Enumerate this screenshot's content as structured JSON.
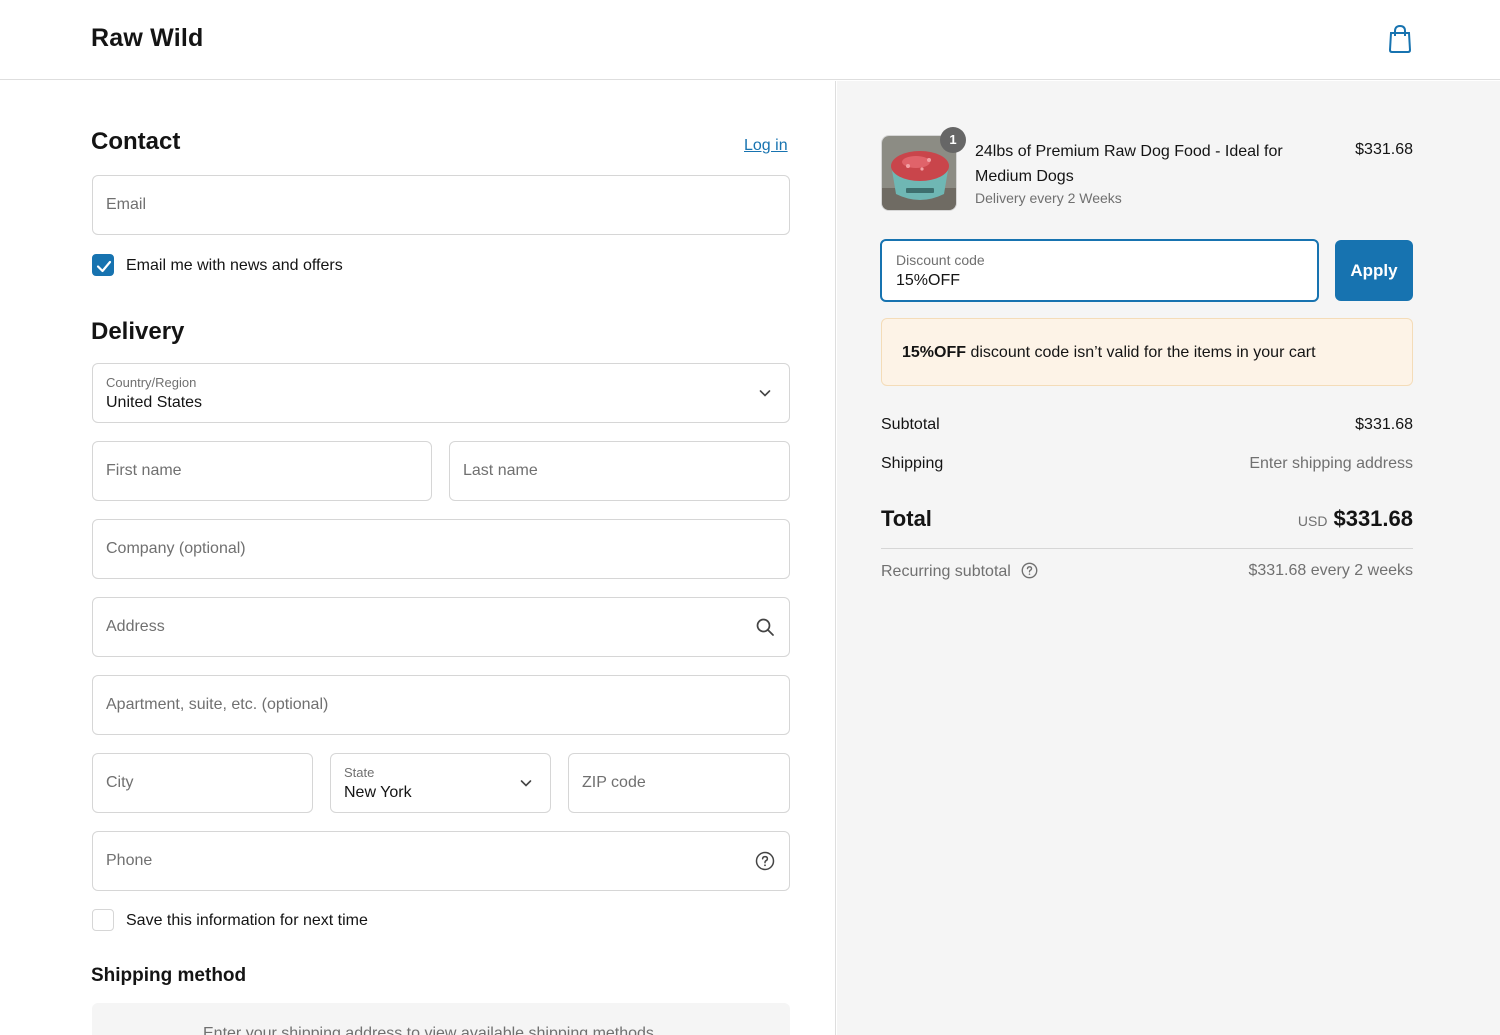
{
  "header": {
    "brand": "Raw Wild",
    "cart_icon": "shopping-bag-icon"
  },
  "contact": {
    "title": "Contact",
    "login_link": "Log in",
    "email_placeholder": "Email",
    "newsletter_label": "Email me with news and offers",
    "newsletter_checked": true
  },
  "delivery": {
    "title": "Delivery",
    "country_label": "Country/Region",
    "country_value": "United States",
    "first_name_placeholder": "First name",
    "last_name_placeholder": "Last name",
    "company_placeholder": "Company (optional)",
    "address_placeholder": "Address",
    "apartment_placeholder": "Apartment, suite, etc. (optional)",
    "city_placeholder": "City",
    "state_label": "State",
    "state_value": "New York",
    "zip_placeholder": "ZIP code",
    "phone_placeholder": "Phone",
    "save_info_label": "Save this information for next time",
    "save_info_checked": false
  },
  "shipping_method": {
    "title": "Shipping method",
    "placeholder_text": "Enter your shipping address to view available shipping methods."
  },
  "summary": {
    "product": {
      "quantity": "1",
      "name": "24lbs of Premium Raw Dog Food - Ideal for Medium Dogs",
      "subscription": "Delivery every 2 Weeks",
      "price": "$331.68"
    },
    "discount": {
      "label": "Discount code",
      "value": "15%OFF",
      "apply_label": "Apply"
    },
    "warning": {
      "code": "15%OFF",
      "message": " discount code isn’t valid for the items in your cart"
    },
    "subtotal_label": "Subtotal",
    "subtotal_value": "$331.68",
    "shipping_label": "Shipping",
    "shipping_value": "Enter shipping address",
    "total_label": "Total",
    "total_currency": "USD",
    "total_value": "$331.68",
    "recurring_label": "Recurring subtotal",
    "recurring_value": "$331.68 every 2 weeks"
  },
  "colors": {
    "accent": "#1773b0",
    "warning_bg": "#fdf3e7",
    "summary_bg": "#f5f5f5"
  }
}
